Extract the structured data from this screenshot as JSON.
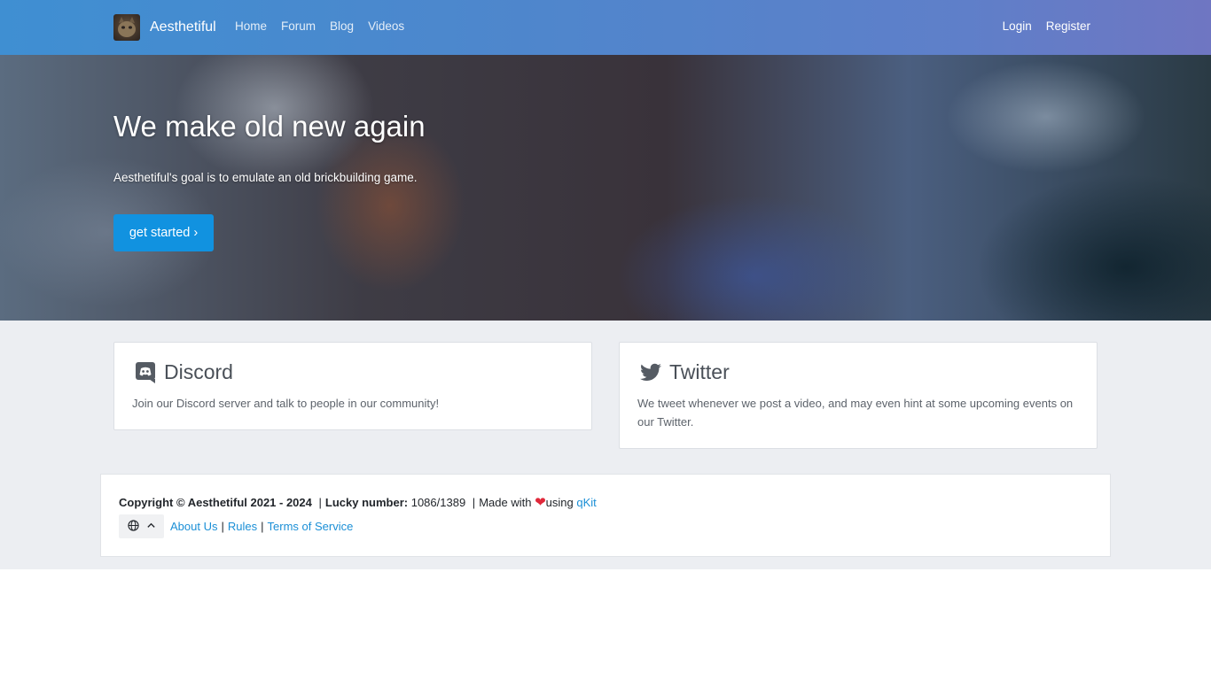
{
  "navbar": {
    "brand": "Aesthetiful",
    "links": [
      "Home",
      "Forum",
      "Blog",
      "Videos"
    ],
    "login": "Login",
    "register": "Register"
  },
  "hero": {
    "title": "We make old new again",
    "subtitle": "Aesthetiful's goal is to emulate an old brickbuilding game.",
    "cta": "get started ›"
  },
  "cards": {
    "discord": {
      "title": "Discord",
      "icon": "discord-icon",
      "text": "Join our Discord server and talk to people in our community!"
    },
    "twitter": {
      "title": "Twitter",
      "icon": "twitter-icon",
      "text": "We tweet whenever we post a video, and may even hint at some upcoming events on our Twitter."
    }
  },
  "footer": {
    "copyright": "Copyright © Aesthetiful 2021 - 2024",
    "lucky_label": "Lucky number:",
    "lucky_value": "1086/1389",
    "made_with": "Made with",
    "using": "using",
    "qkit": "qKit",
    "links": [
      "About Us",
      "Rules",
      "Terms of Service"
    ]
  },
  "colors": {
    "accent": "#1192e0",
    "link": "#1b8fd6",
    "heart": "#e0283a"
  }
}
